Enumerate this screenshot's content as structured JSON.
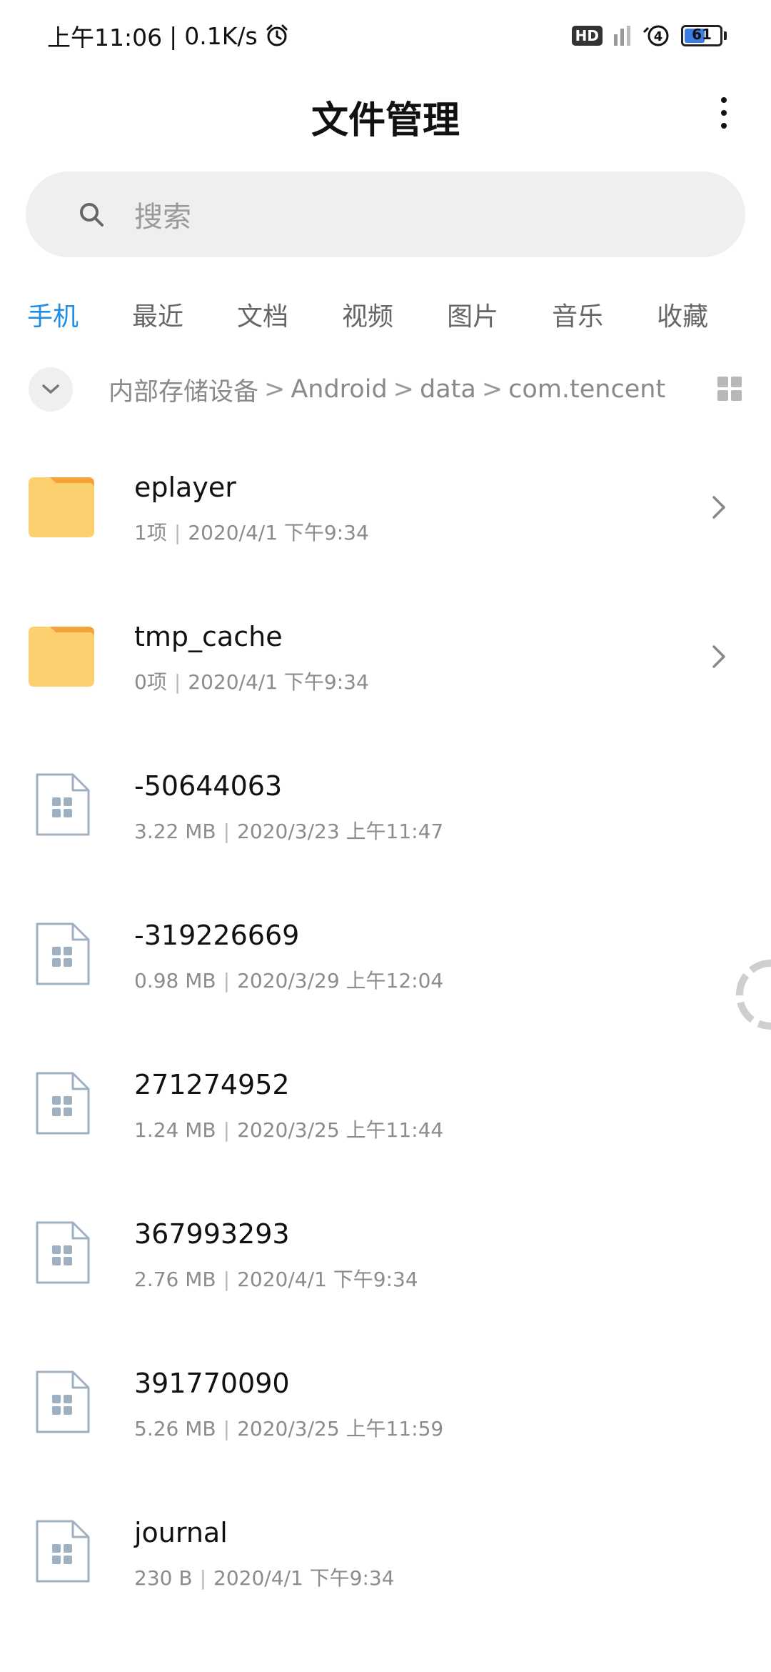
{
  "status_bar": {
    "time": "上午11:06",
    "net_speed": "0.1K/s",
    "separator": "|",
    "hd_label": "HD",
    "network_label": "4",
    "battery_level": "61"
  },
  "header": {
    "title": "文件管理"
  },
  "search": {
    "placeholder": "搜索"
  },
  "tabs": [
    {
      "label": "手机",
      "active": true
    },
    {
      "label": "最近"
    },
    {
      "label": "文档"
    },
    {
      "label": "视频"
    },
    {
      "label": "图片"
    },
    {
      "label": "音乐"
    },
    {
      "label": "收藏"
    }
  ],
  "breadcrumb": {
    "items": [
      "内部存储设备",
      "Android",
      "data",
      "com.tencent"
    ],
    "separator": ">"
  },
  "files": [
    {
      "name": "eplayer",
      "size": "1项",
      "date": "2020/4/1 下午9:34",
      "type": "folder"
    },
    {
      "name": "tmp_cache",
      "size": "0项",
      "date": "2020/4/1 下午9:34",
      "type": "folder"
    },
    {
      "name": "-50644063",
      "size": "3.22 MB",
      "date": "2020/3/23 上午11:47",
      "type": "file"
    },
    {
      "name": "-319226669",
      "size": "0.98 MB",
      "date": "2020/3/29 上午12:04",
      "type": "file"
    },
    {
      "name": "271274952",
      "size": "1.24 MB",
      "date": "2020/3/25 上午11:44",
      "type": "file"
    },
    {
      "name": "367993293",
      "size": "2.76 MB",
      "date": "2020/4/1 下午9:34",
      "type": "file"
    },
    {
      "name": "391770090",
      "size": "5.26 MB",
      "date": "2020/3/25 上午11:59",
      "type": "file"
    },
    {
      "name": "journal",
      "size": "230 B",
      "date": "2020/4/1 下午9:34",
      "type": "file"
    }
  ],
  "meta_separator": "|",
  "colors": {
    "accent": "#1d8de6",
    "folder": "#fdd06f",
    "folder_tab": "#f5a238",
    "file_icon": "#9fb0c0"
  },
  "icons": {
    "search": "search-icon",
    "more": "more-vert-icon",
    "collapse": "chevron-down-icon",
    "grid_view": "grid-view-icon",
    "folder": "folder-icon",
    "file": "file-icon",
    "chevron": "chevron-right-icon",
    "alarm": "alarm-icon",
    "loading": "loading-spinner-icon"
  }
}
